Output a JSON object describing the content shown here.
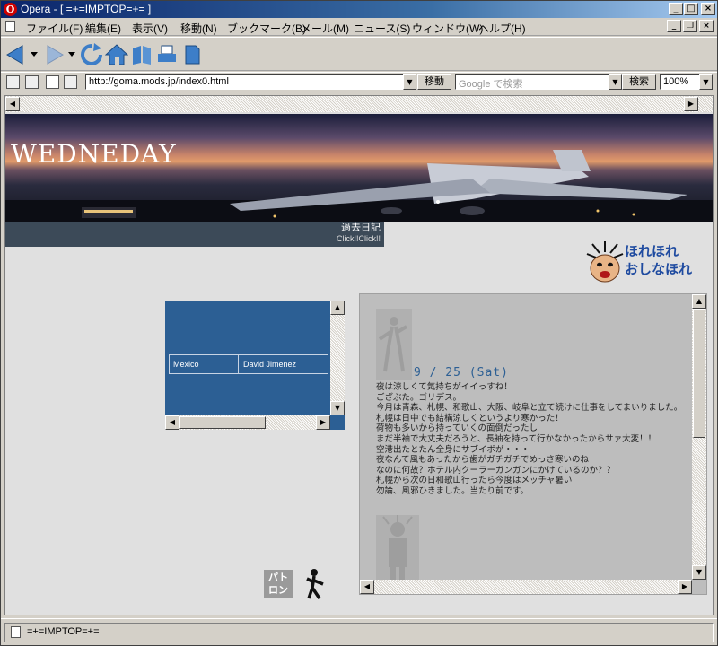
{
  "window": {
    "title": "Opera - [ =+=IMPTOP=+= ]",
    "app_icon": "opera-o-icon",
    "buttons": {
      "minimize": "_",
      "maximize": "□",
      "close": "×"
    }
  },
  "menu": {
    "items": [
      {
        "label": "ファイル(F)"
      },
      {
        "label": "編集(E)"
      },
      {
        "label": "表示(V)"
      },
      {
        "label": "移動(N)"
      },
      {
        "label": "ブックマーク(B)"
      },
      {
        "label": "メール(M)"
      },
      {
        "label": "ニュース(S)"
      },
      {
        "label": "ウィンドウ(W)"
      },
      {
        "label": "ヘルプ(H)"
      }
    ],
    "mdi": {
      "minimize": "_",
      "restore": "❐",
      "close": "×"
    }
  },
  "nav": {
    "icons": [
      "back-arrow-icon",
      "forward-arrow-icon",
      "reload-icon",
      "home-icon",
      "hotlist-icon",
      "print-icon",
      "new-page-icon"
    ]
  },
  "address": {
    "url": "http://goma.mods.jp/index0.html",
    "go_label": "移動",
    "search_placeholder": "Google で検索",
    "search_label": "検索",
    "zoom": "100%"
  },
  "page": {
    "banner_title": "WEDNEDAY",
    "past_diary_label": "過去日記",
    "past_diary_sub": "Click!!Click!!",
    "logo_text_line1": "ほれほれ",
    "logo_text_line2": "おしなほれ",
    "link_table": {
      "rows": [
        {
          "country": "Mexico",
          "name": "David Jimenez"
        }
      ]
    },
    "diary": {
      "date": "9 / 25 (Sat)",
      "lines": [
        "夜は涼しくて気持ちがイイっすね！",
        "ござぶた。ゴリデス。",
        "今月は青森、札幌、和歌山、大阪、岐阜と立て続けに仕事をしてまいりました。",
        "札幌は日中でも結構涼しくというより寒かった！",
        "荷物も多いから持っていくの面倒だったし",
        "まだ半袖で大丈夫だろうと、長袖を持って行かなかったからサァ大変！！",
        "空港出たとたん全身にサブイボが・・・",
        "夜なんて風もあったから歯がガチガチでめっさ寒いのね",
        "なのに何故？ホテル内クーラーガンガンにかけているのか？？",
        "札幌から次の日和歌山行ったら今度はメッチャ暑い",
        "勿論、風邪ひきました。当たり前です。"
      ]
    },
    "bottom_icon_text": "パト ロン"
  },
  "status": {
    "text": "=+=IMPTOP=+="
  },
  "colors": {
    "accent": "#2c5f94",
    "titlebar": "#0a246a"
  }
}
